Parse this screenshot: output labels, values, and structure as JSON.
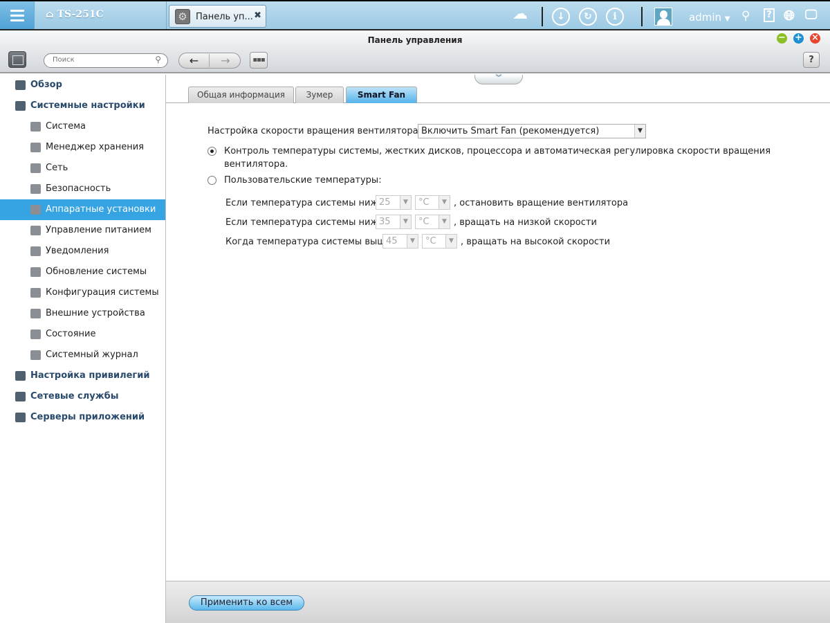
{
  "topbar": {
    "device_name": "TS-251C",
    "app_tab_label": "Панель уп...",
    "user": "admin"
  },
  "window": {
    "title": "Панель управления",
    "search_placeholder": "Поиск",
    "help_label": "?"
  },
  "sidebar": {
    "items": [
      {
        "label": "Обзор",
        "level": "top"
      },
      {
        "label": "Системные настройки",
        "level": "top"
      },
      {
        "label": "Система",
        "level": "sub"
      },
      {
        "label": "Менеджер хранения",
        "level": "sub"
      },
      {
        "label": "Сеть",
        "level": "sub"
      },
      {
        "label": "Безопасность",
        "level": "sub"
      },
      {
        "label": "Аппаратные установки",
        "level": "sub",
        "active": true
      },
      {
        "label": "Управление питанием",
        "level": "sub"
      },
      {
        "label": "Уведомления",
        "level": "sub"
      },
      {
        "label": "Обновление системы",
        "level": "sub"
      },
      {
        "label": "Конфигурация системы",
        "level": "sub"
      },
      {
        "label": "Внешние устройства",
        "level": "sub"
      },
      {
        "label": "Состояние",
        "level": "sub"
      },
      {
        "label": "Системный журнал",
        "level": "sub"
      },
      {
        "label": "Настройка привилегий",
        "level": "top"
      },
      {
        "label": "Сетевые службы",
        "level": "top"
      },
      {
        "label": "Серверы приложений",
        "level": "top"
      }
    ]
  },
  "tabs": [
    "Общая информация",
    "Зумер",
    "Smart Fan"
  ],
  "form": {
    "fan_label": "Настройка скорости вращения вентилятора:",
    "fan_mode": "Включить Smart Fan (рекомендуется)",
    "radio_auto": "Контроль температуры системы, жестких дисков, процессора и автоматическая регулировка скорости вращения",
    "radio_auto_line2": "вентилятора.",
    "radio_custom": "Пользовательские температуры:",
    "rows": [
      {
        "prefix": "Если температура системы ниже",
        "value": "25",
        "unit": "°C",
        "suffix": ", остановить вращение вентилятора"
      },
      {
        "prefix": "Если температура системы ниже",
        "value": "35",
        "unit": "°C",
        "suffix": ", вращать на низкой скорости"
      },
      {
        "prefix": "Когда температура системы выше",
        "value": "45",
        "unit": "°C",
        "suffix": ", вращать на высокой скорости"
      }
    ]
  },
  "footer": {
    "apply_label": "Применить ко всем"
  }
}
